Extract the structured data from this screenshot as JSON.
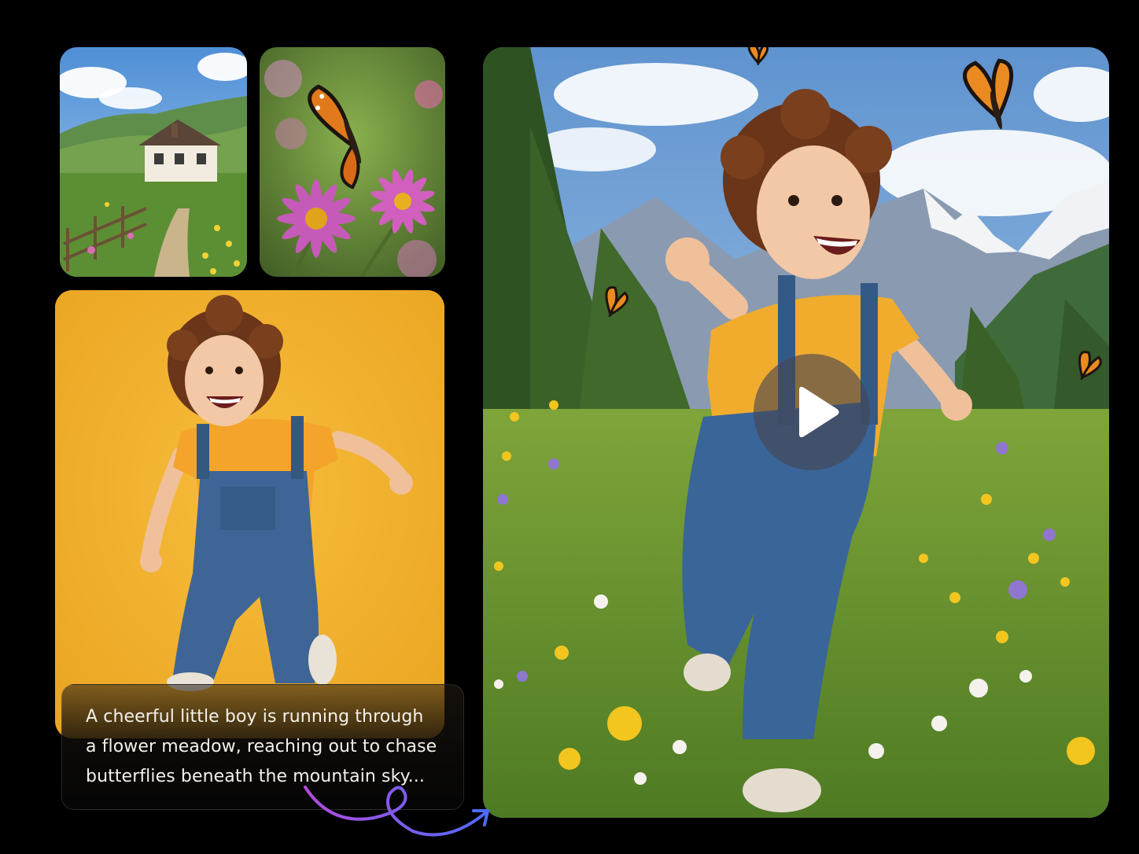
{
  "caption": {
    "lines": [
      "A cheerful little boy is running through",
      "a flower meadow, reaching out to chase",
      "butterflies beneath the mountain sky..."
    ]
  },
  "images": {
    "house": "cottage-meadow-image",
    "flower": "butterfly-on-flower-image",
    "studio": "boy-yellow-backdrop-image",
    "video": "boy-chasing-butterflies-video"
  },
  "controls": {
    "play_icon": "play-icon"
  },
  "colors": {
    "background": "#000000",
    "studio_backdrop": "#f0ae2c",
    "arrow_start": "#b44bd8",
    "arrow_end": "#4f6bff"
  }
}
